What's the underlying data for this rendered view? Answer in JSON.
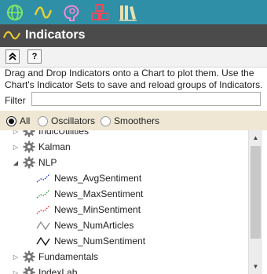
{
  "icon_bar": {
    "icons": [
      "globe-icon",
      "indicator-wave-icon",
      "brain-icon",
      "blocks-icon",
      "library-icon"
    ],
    "colors": {
      "background": "#2f8fa6",
      "globe": "#7ee36a",
      "wave": "#f2d02c",
      "brain": "#f08ad6",
      "blocks": "#f04b5a",
      "library": "#e8e0b0"
    }
  },
  "header": {
    "title": "Indicators",
    "icon": "indicator-wave-icon"
  },
  "toolbar": {
    "collapse_label": "«",
    "help_label": "?"
  },
  "description": "Drag and Drop Indicators onto a Chart to plot them. Use the Chart's Indicator Sets to save and reload groups of Indicators.",
  "filter": {
    "label": "Filter",
    "value": "",
    "placeholder": ""
  },
  "radios": {
    "options": [
      {
        "label": "All",
        "selected": true
      },
      {
        "label": "Oscillators",
        "selected": false
      },
      {
        "label": "Smoothers",
        "selected": false
      }
    ]
  },
  "tree": {
    "items": [
      {
        "label": "IndicUtilities",
        "kind": "group",
        "expanded": false
      },
      {
        "label": "Kalman",
        "kind": "group",
        "expanded": false
      },
      {
        "label": "NLP",
        "kind": "group",
        "expanded": true
      },
      {
        "label": "News_AvgSentiment",
        "kind": "indicator",
        "icon_color": "#2a3bd6"
      },
      {
        "label": "News_MaxSentiment",
        "kind": "indicator",
        "icon_color": "#2a9d3a"
      },
      {
        "label": "News_MinSentiment",
        "kind": "indicator",
        "icon_color": "#e03030"
      },
      {
        "label": "News_NumArticles",
        "kind": "indicator",
        "icon_color": "#909090"
      },
      {
        "label": "News_NumSentiment",
        "kind": "indicator",
        "icon_color": "#111111"
      },
      {
        "label": "Fundamentals",
        "kind": "group",
        "expanded": false
      },
      {
        "label": "IndexLab",
        "kind": "group",
        "expanded": false
      }
    ]
  },
  "scrollbar": {
    "up_glyph": "▲",
    "down_glyph": "▼"
  }
}
